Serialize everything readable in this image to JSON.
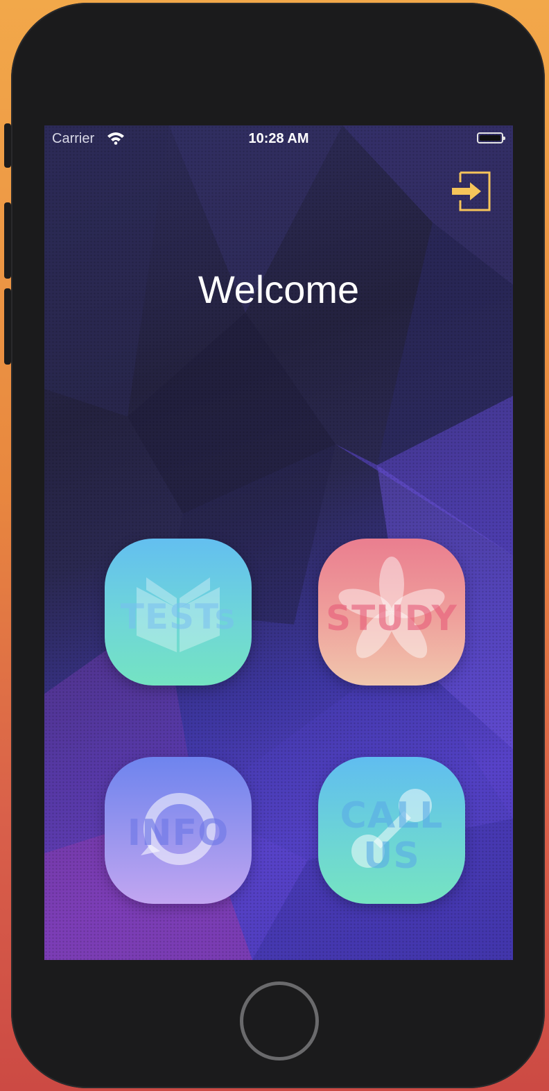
{
  "status_bar": {
    "carrier": "Carrier",
    "time": "10:28 AM"
  },
  "header": {
    "welcome": "Welcome"
  },
  "tiles": {
    "tests": {
      "label": "TESTs",
      "icon": "open-book-icon"
    },
    "study": {
      "label": "STUDY",
      "icon": "flower-icon"
    },
    "info": {
      "label": "INFO",
      "icon": "chat-bubble-icon"
    },
    "call": {
      "label_line1": "CALL",
      "label_line2": "US",
      "icon": "phone-handset-icon"
    }
  },
  "icons": {
    "login": "login-arrow-icon",
    "home": "home-button"
  },
  "colors": {
    "login_icon": "#f5c45a",
    "welcome_text": "#ffffff"
  }
}
